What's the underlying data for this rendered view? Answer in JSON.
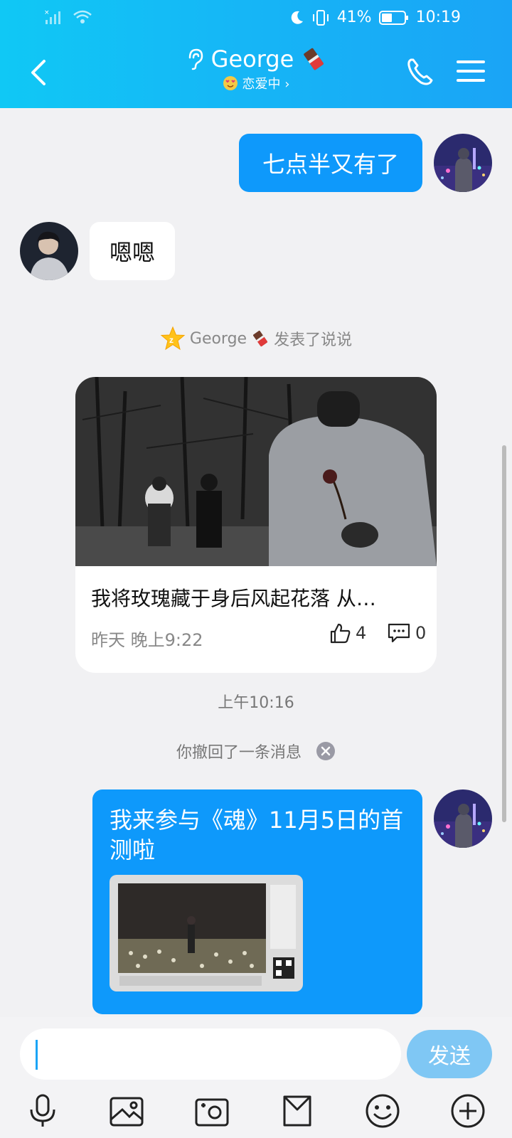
{
  "status_bar": {
    "battery": "41%",
    "time": "10:19"
  },
  "header": {
    "title": "George",
    "subtitle": "恋爱中 ›"
  },
  "messages": [
    {
      "side": "outgoing",
      "text": "七点半又有了"
    },
    {
      "side": "incoming",
      "text": "嗯嗯"
    }
  ],
  "shuoshuo_notice": "George",
  "shuoshuo_notice_suffix": "发表了说说",
  "shared_post": {
    "title": "我将玫瑰藏于身后风起花落 从…",
    "time": "昨天 晚上9:22",
    "likes": "4",
    "comments": "0"
  },
  "timestamp": "上午10:16",
  "recall_notice": "你撤回了一条消息",
  "share_message": {
    "text": "我来参与《魂》11月5日的首测啦"
  },
  "input": {
    "placeholder": "",
    "send_label": "发送"
  },
  "toolbar_icons": [
    "microphone-icon",
    "image-icon",
    "camera-icon",
    "file-icon",
    "emoji-icon",
    "plus-icon"
  ],
  "colors": {
    "header_gradient_start": "#10c8f5",
    "header_gradient_end": "#1aa4f6",
    "outgoing_bubble": "#0e99fb",
    "send_button": "#7fc7f4"
  }
}
